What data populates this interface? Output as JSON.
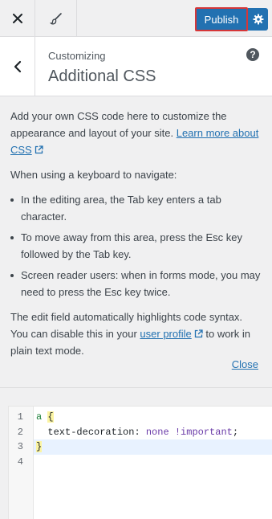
{
  "toolbar": {
    "close_icon": "close-icon",
    "brush_icon": "brush-icon",
    "publish_label": "Publish",
    "gear_icon": "gear-icon"
  },
  "header": {
    "breadcrumb": "Customizing",
    "title": "Additional CSS",
    "help_label": "?"
  },
  "description": {
    "intro_text": "Add your own CSS code here to customize the appearance and layout of your site.",
    "intro_link": "Learn more about CSS",
    "keyboard_heading": "When using a keyboard to navigate:",
    "bullets": [
      "In the editing area, the Tab key enters a tab character.",
      "To move away from this area, press the Esc key followed by the Tab key.",
      "Screen reader users: when in forms mode, you may need to press the Esc key twice."
    ],
    "syntax_text_1": "The edit field automatically highlights code syntax. You can disable this in your",
    "syntax_link": "user profile",
    "syntax_text_2": "to work in plain text mode.",
    "close_label": "Close"
  },
  "editor": {
    "line_numbers": [
      "1",
      "2",
      "3",
      "4"
    ],
    "lines": [
      "a {",
      "  text-decoration: none !important;",
      "}",
      ""
    ],
    "tokens": {
      "selector": "a",
      "open_brace": "{",
      "property": "text-decoration",
      "colon": ":",
      "value": "none !important",
      "semicolon": ";",
      "close_brace": "}"
    },
    "active_line": 3
  },
  "colors": {
    "accent": "#2271b1",
    "highlight_outline": "#d63638",
    "panel_bg": "#f0f0f1"
  }
}
